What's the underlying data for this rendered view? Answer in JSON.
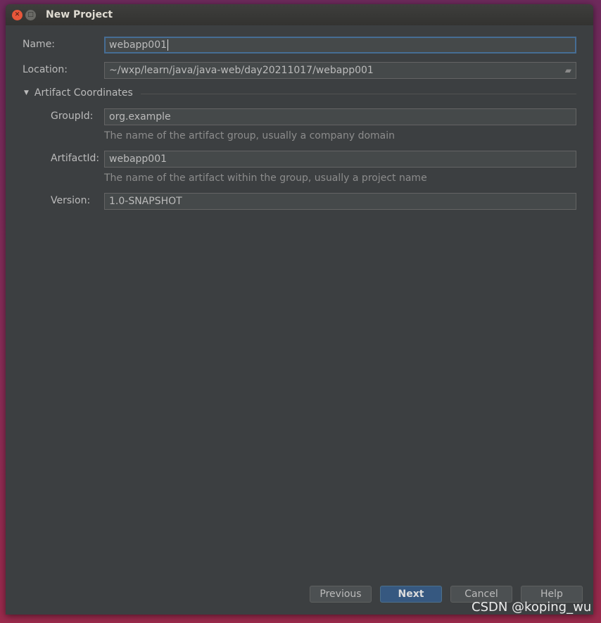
{
  "window": {
    "title": "New Project"
  },
  "form": {
    "name_label": "Name:",
    "name_value": "webapp001",
    "location_label": "Location:",
    "location_value": "~/wxp/learn/java/java-web/day20211017/webapp001",
    "section_title": "Artifact Coordinates",
    "groupid_label": "GroupId:",
    "groupid_value": "org.example",
    "groupid_hint": "The name of the artifact group, usually a company domain",
    "artifactid_label": "ArtifactId:",
    "artifactid_value": "webapp001",
    "artifactid_hint": "The name of the artifact within the group, usually a project name",
    "version_label": "Version:",
    "version_value": "1.0-SNAPSHOT"
  },
  "buttons": {
    "previous": "Previous",
    "next": "Next",
    "cancel": "Cancel",
    "help": "Help"
  },
  "watermark": "CSDN @koping_wu"
}
